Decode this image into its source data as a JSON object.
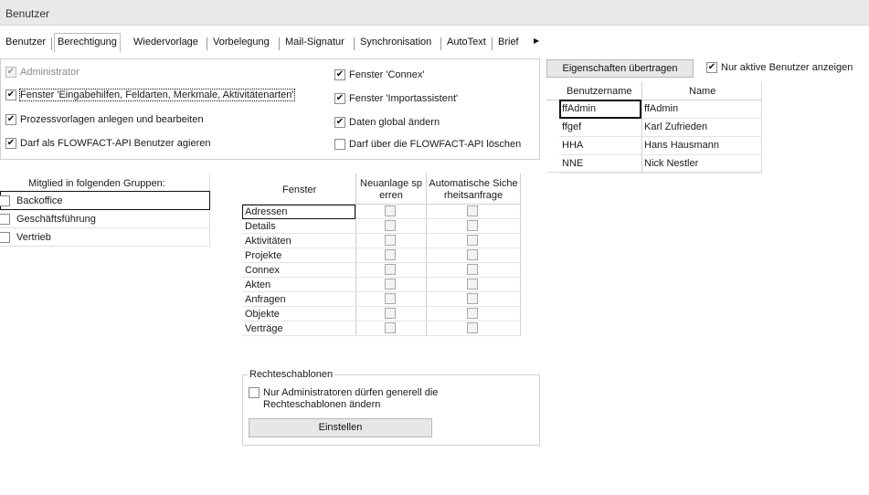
{
  "window": {
    "title": "Benutzer"
  },
  "tabs": [
    "Benutzer",
    "Berechtigung",
    "Wiedervorlage",
    "Vorbelegung",
    "Mail-Signatur",
    "Synchronisation",
    "AutoText",
    "Brief"
  ],
  "permissions_left": [
    {
      "label": "Administrator",
      "checked": true,
      "disabled": true
    },
    {
      "label": "Fenster 'Eingabehilfen, Feldarten, Merkmale, Aktivitätenarten'",
      "checked": true
    },
    {
      "label": "Prozessvorlagen anlegen und bearbeiten",
      "checked": true
    },
    {
      "label": "Darf als FLOWFACT-API Benutzer agieren",
      "checked": true
    }
  ],
  "permissions_right": [
    {
      "label": "Fenster 'Connex'",
      "checked": true
    },
    {
      "label": "Fenster 'Importassistent'",
      "checked": true
    },
    {
      "label": "Daten global ändern",
      "checked": true
    },
    {
      "label": "Darf über die FLOWFACT-API löschen",
      "checked": false
    }
  ],
  "groups": {
    "header": "Mitglied in folgenden Gruppen:",
    "items": [
      {
        "label": "Backoffice",
        "checked": false
      },
      {
        "label": "Geschäftsführung",
        "checked": false
      },
      {
        "label": "Vertrieb",
        "checked": false
      }
    ]
  },
  "window_grid": {
    "col_fenster": "Fenster",
    "col_neuanlage_line1": "Neuanlage sp",
    "col_neuanlage_line2": "erren",
    "col_auto_line1": "Automatische Siche",
    "col_auto_line2": "rheitsanfrage",
    "rows": [
      {
        "name": "Adressen",
        "neuanlage": false,
        "auto": false
      },
      {
        "name": "Details",
        "neuanlage": false,
        "auto": false
      },
      {
        "name": "Aktivitäten",
        "neuanlage": false,
        "auto": false
      },
      {
        "name": "Projekte",
        "neuanlage": false,
        "auto": false
      },
      {
        "name": "Connex",
        "neuanlage": false,
        "auto": false
      },
      {
        "name": "Akten",
        "neuanlage": false,
        "auto": false
      },
      {
        "name": "Anfragen",
        "neuanlage": false,
        "auto": false
      },
      {
        "name": "Objekte",
        "neuanlage": false,
        "auto": false
      },
      {
        "name": "Verträge",
        "neuanlage": false,
        "auto": false
      }
    ]
  },
  "rights_templates": {
    "title": "Rechteschablonen",
    "checkbox_label_line1": "Nur Administratoren dürfen generell die",
    "checkbox_label_line2": "Rechteschablonen ändern",
    "checked": false,
    "button_label": "Einstellen"
  },
  "users_panel": {
    "transfer_button": "Eigenschaften übertragen",
    "only_active_label": "Nur aktive Benutzer anzeigen",
    "only_active_checked": true,
    "col_username": "Benutzername",
    "col_name": "Name",
    "rows": [
      {
        "username": "ffAdmin",
        "name": "ffAdmin"
      },
      {
        "username": "ffgef",
        "name": "Karl Zufrieden"
      },
      {
        "username": "HHA",
        "name": "Hans Hausmann"
      },
      {
        "username": "NNE",
        "name": "Nick Nestler"
      }
    ]
  }
}
